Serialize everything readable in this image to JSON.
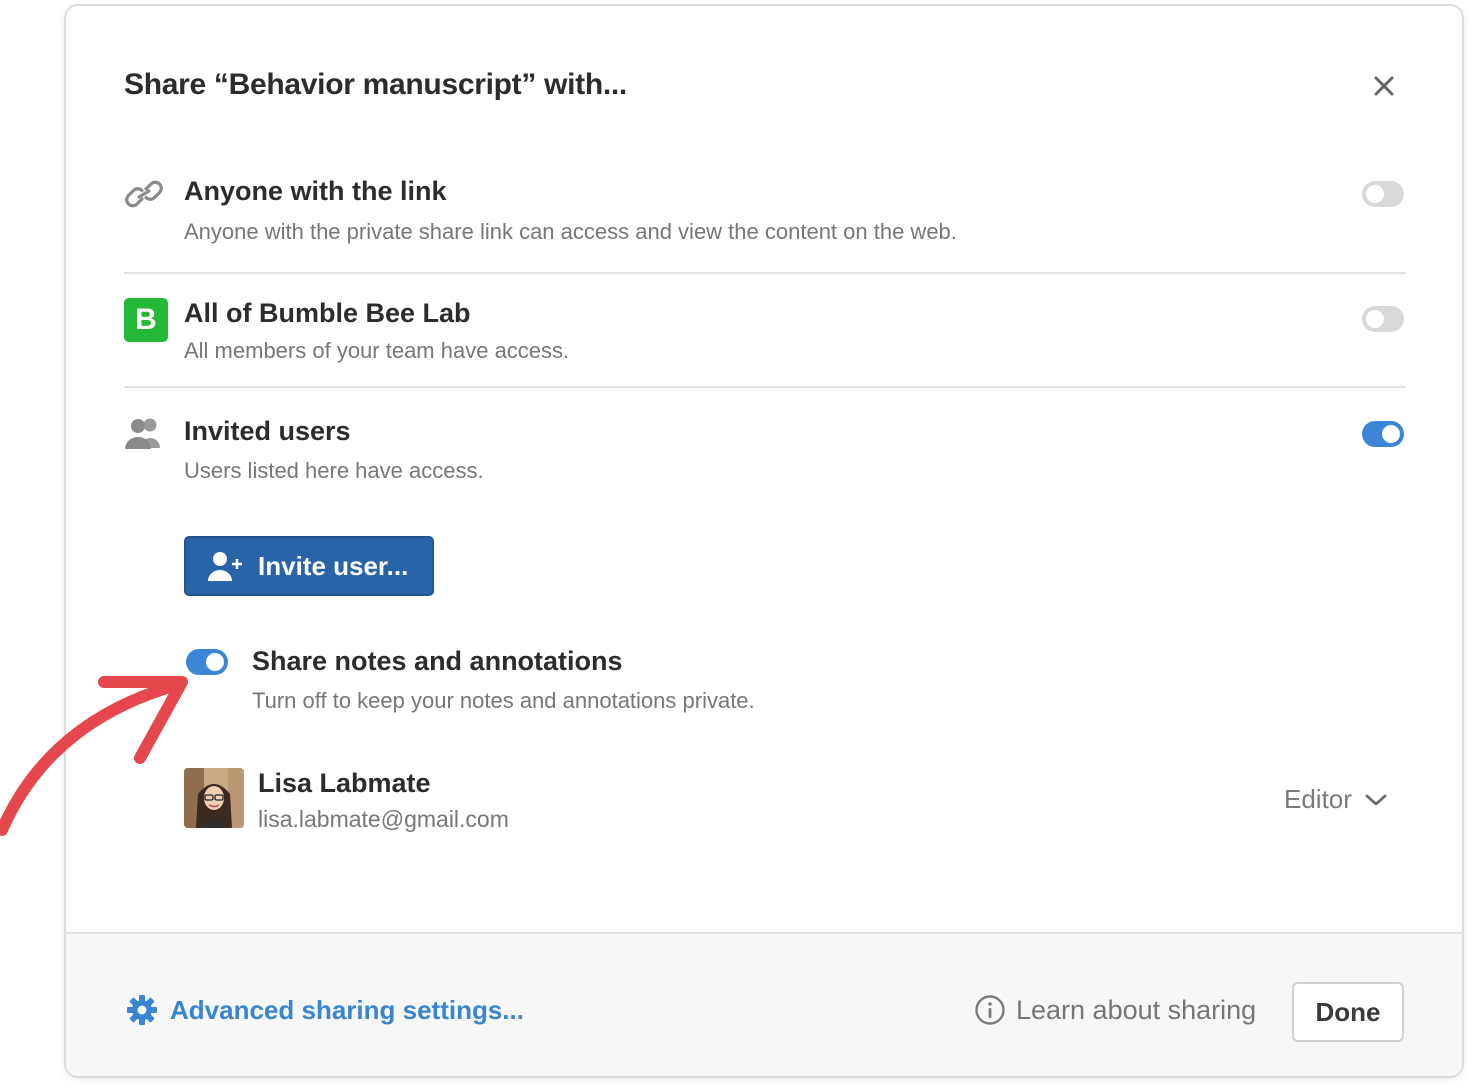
{
  "dialog": {
    "title": "Share “Behavior manuscript” with..."
  },
  "link_sharing": {
    "title": "Anyone with the link",
    "description": "Anyone with the private share link can access and view the content on the web.",
    "enabled": false
  },
  "team_sharing": {
    "badge": "B",
    "title": "All of Bumble Bee Lab",
    "description": "All members of your team have access.",
    "enabled": false
  },
  "invited_users": {
    "title": "Invited users",
    "description": "Users listed here have access.",
    "enabled": true,
    "invite_button_label": "Invite user..."
  },
  "notes_sharing": {
    "title": "Share notes and annotations",
    "description": "Turn off to keep your notes and annotations private.",
    "enabled": true
  },
  "users": [
    {
      "name": "Lisa Labmate",
      "email": "lisa.labmate@gmail.com",
      "role": "Editor"
    }
  ],
  "footer": {
    "advanced_label": "Advanced sharing settings...",
    "learn_label": "Learn about sharing",
    "done_label": "Done"
  },
  "colors": {
    "accent": "#3b86d6",
    "button_primary": "#2a64a8",
    "team_badge": "#23b937",
    "annotation_arrow": "#e5474d"
  },
  "icons": [
    "link-icon",
    "close-icon",
    "team-badge-icon",
    "users-icon",
    "add-user-icon",
    "chevron-down-icon",
    "gear-icon",
    "info-icon"
  ]
}
